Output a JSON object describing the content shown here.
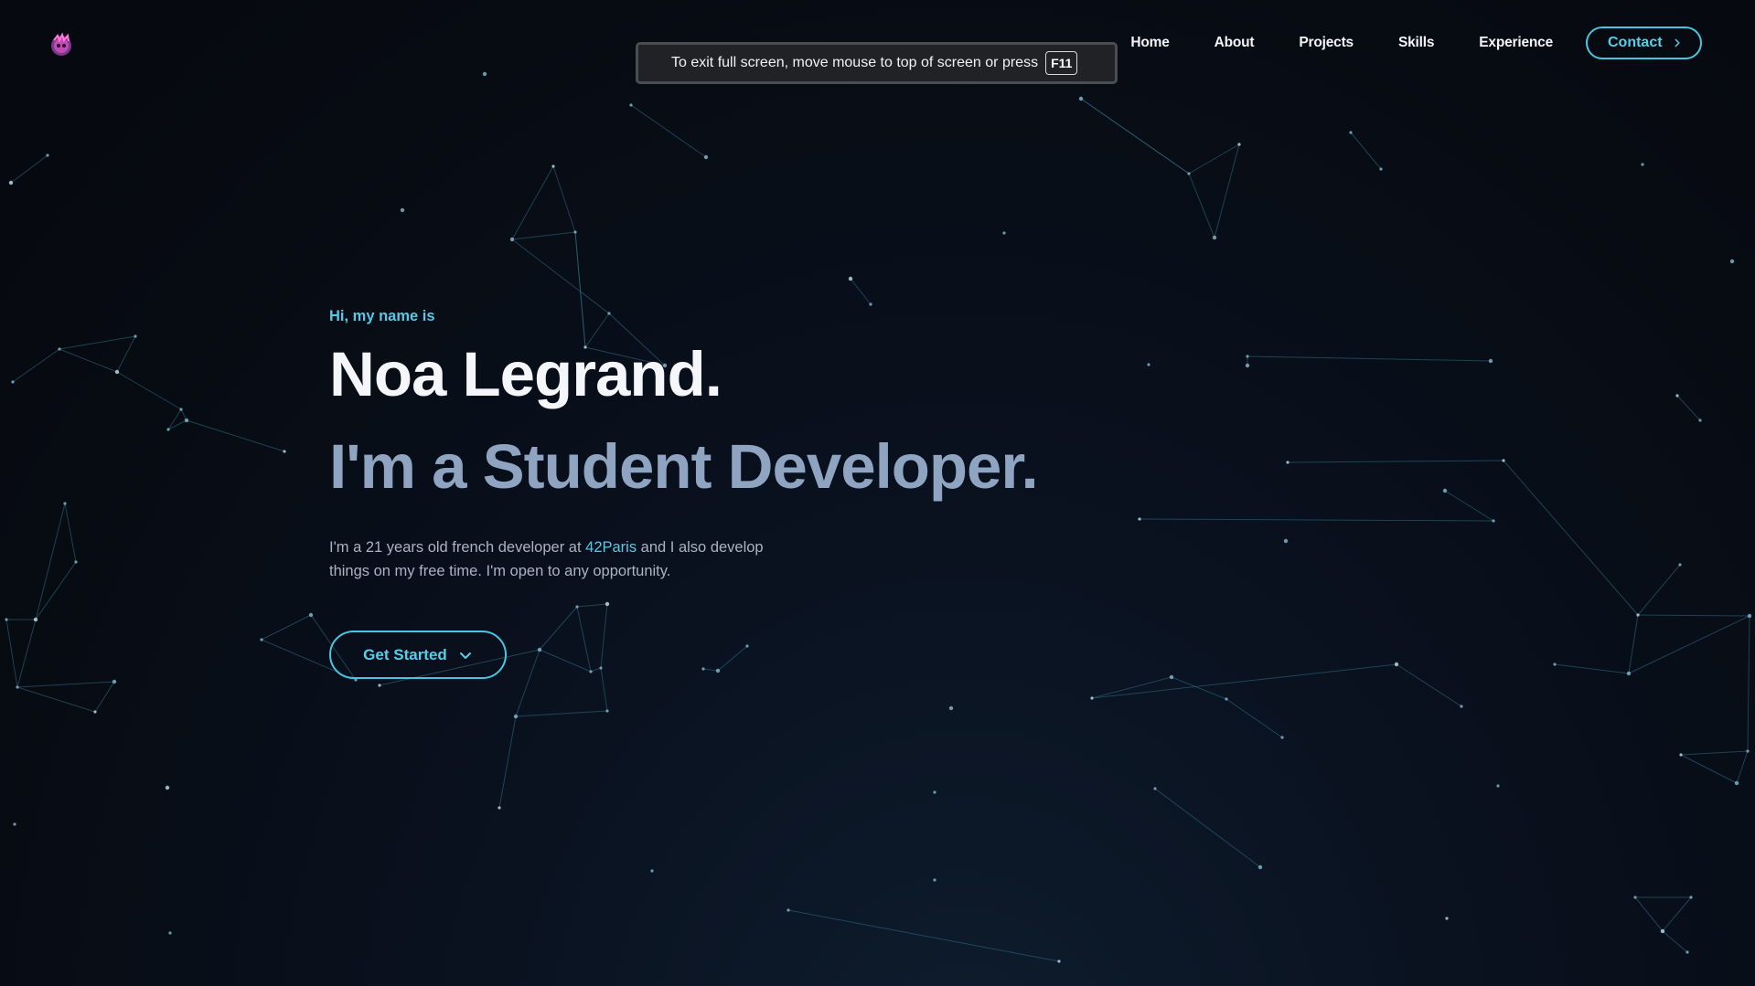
{
  "nav": {
    "logo": "logo-icon",
    "items": [
      {
        "label": "Home"
      },
      {
        "label": "About"
      },
      {
        "label": "Projects"
      },
      {
        "label": "Skills"
      },
      {
        "label": "Experience"
      }
    ],
    "contact_label": "Contact"
  },
  "fullscreen_notice": {
    "text": "To exit full screen, move mouse to top of screen or press",
    "key": "F11"
  },
  "hero": {
    "greeting": "Hi, my name is",
    "name": "Noa Legrand.",
    "role": "I'm a Student Developer.",
    "description_before": "I'm a 21 years old french developer at ",
    "description_highlight": "42Paris",
    "description_after": " and I also develop things on my free time. I'm open to any opportunity.",
    "cta_label": "Get Started"
  },
  "colors": {
    "accent": "#57c9e6",
    "background": "#080c14",
    "heading": "#f4f6f9",
    "subheading": "#8ea4c0",
    "body_text": "#a9b3c2"
  }
}
